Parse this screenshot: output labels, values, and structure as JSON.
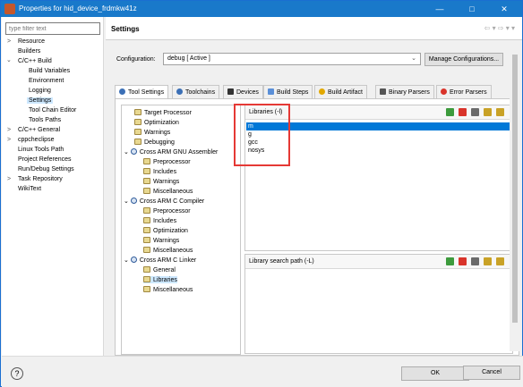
{
  "window": {
    "title": "Properties for hid_device_frdmkw41z",
    "minimize": "—",
    "maximize": "□",
    "close": "✕"
  },
  "left": {
    "filter_placeholder": "type filter text",
    "items": [
      {
        "label": "Resource",
        "arrow": ">"
      },
      {
        "label": "Builders"
      },
      {
        "label": "C/C++ Build",
        "arrow": "⌄"
      },
      {
        "label": "Build Variables"
      },
      {
        "label": "Environment"
      },
      {
        "label": "Logging"
      },
      {
        "label": "Settings"
      },
      {
        "label": "Tool Chain Editor"
      },
      {
        "label": "Tools Paths"
      },
      {
        "label": "C/C++ General",
        "arrow": ">"
      },
      {
        "label": "cppcheclipse",
        "arrow": ">"
      },
      {
        "label": "Linux Tools Path"
      },
      {
        "label": "Project References"
      },
      {
        "label": "Run/Debug Settings"
      },
      {
        "label": "Task Repository",
        "arrow": ">"
      },
      {
        "label": "WikiText"
      }
    ]
  },
  "header": {
    "title": "Settings",
    "nav": "⇦ ▾ ⇨ ▾ ▾"
  },
  "config": {
    "label": "Configuration:",
    "value": "debug  [ Active ]",
    "manage_label": "Manage Configurations..."
  },
  "tabs": [
    {
      "label": "Tool Settings",
      "icon_color": "#3b6fb6"
    },
    {
      "label": "Toolchains",
      "icon_color": "#3b6fb6"
    },
    {
      "label": "Devices",
      "icon_color": "#333333"
    },
    {
      "label": "Build Steps",
      "icon_color": "#5a8fd8"
    },
    {
      "label": "Build Artifact",
      "icon_color": "#e2a800"
    },
    {
      "label": "Binary Parsers",
      "icon_color": "#555555"
    },
    {
      "label": "Error Parsers",
      "icon_color": "#d9342b"
    }
  ],
  "settings_tree": [
    {
      "label": "Target Processor"
    },
    {
      "label": "Optimization"
    },
    {
      "label": "Warnings"
    },
    {
      "label": "Debugging"
    },
    {
      "label": "Cross ARM GNU Assembler",
      "arrow": "⌄"
    },
    {
      "label": "Preprocessor"
    },
    {
      "label": "Includes"
    },
    {
      "label": "Warnings"
    },
    {
      "label": "Miscellaneous"
    },
    {
      "label": "Cross ARM C Compiler",
      "arrow": "⌄"
    },
    {
      "label": "Preprocessor"
    },
    {
      "label": "Includes"
    },
    {
      "label": "Optimization"
    },
    {
      "label": "Warnings"
    },
    {
      "label": "Miscellaneous"
    },
    {
      "label": "Cross ARM C Linker",
      "arrow": "⌄"
    },
    {
      "label": "General"
    },
    {
      "label": "Libraries"
    },
    {
      "label": "Miscellaneous"
    }
  ],
  "libraries": {
    "label": "Libraries (-l)",
    "items": [
      "m",
      "g",
      "gcc",
      "nosys"
    ]
  },
  "search_path": {
    "label": "Library search path (-L)"
  },
  "footer": {
    "help": "?",
    "ok_label": "OK",
    "cancel_label": "Cancel"
  }
}
